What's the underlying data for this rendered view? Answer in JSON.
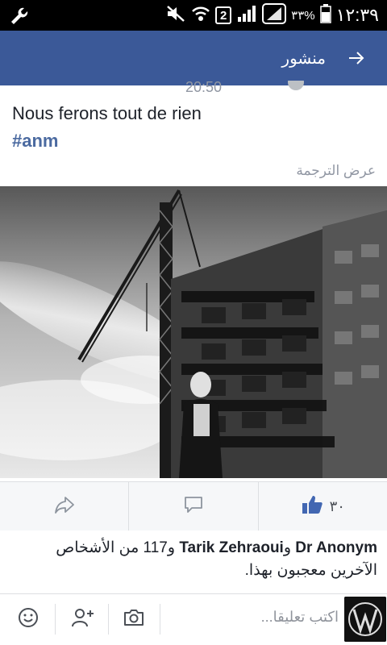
{
  "status_bar": {
    "time": "١٢:٣٩",
    "battery_percent": "٣٣%",
    "sim_slot": "2",
    "icons": [
      "wrench-icon",
      "mute-icon",
      "wifi-icon",
      "signal-icon",
      "signal-outline-icon",
      "battery-icon"
    ]
  },
  "header": {
    "title": "منشور",
    "back_icon": "arrow-right-icon",
    "color": "#3b5998"
  },
  "post": {
    "cut_off_time": "20:50",
    "text": "Nous ferons tout de rien",
    "hashtag": "#anm",
    "translate_label": "عرض الترجمة"
  },
  "actions": {
    "like_count": "٣٠",
    "icons": [
      "like-icon",
      "comment-icon",
      "share-icon"
    ]
  },
  "likes_summary": {
    "name1": "Dr Anonym",
    "name2": "Tarik Zehraoui",
    "connector": "و",
    "rest": "و117 من الأشخاص الآخرين معجبون بهذا."
  },
  "comment_bar": {
    "placeholder": "اكتب تعليقا...",
    "icons": [
      "avatar-icon",
      "camera-icon",
      "add-friend-icon",
      "emoji-icon"
    ]
  }
}
